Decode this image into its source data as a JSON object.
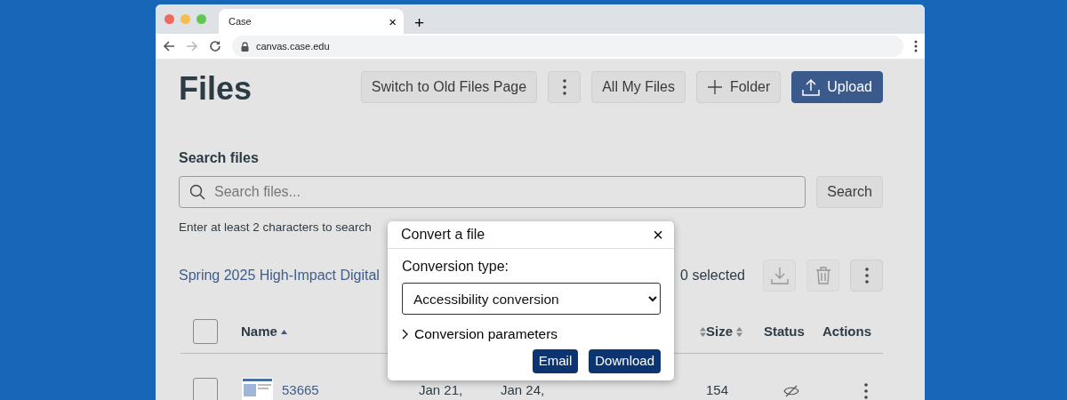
{
  "browser": {
    "tab_title": "Case",
    "tab_close": "×",
    "new_tab": "+",
    "url": "canvas.case.edu",
    "forward_disabled": true
  },
  "page": {
    "title": "Files",
    "toolbar": [
      {
        "kind": "text",
        "label": "Switch to Old Files Page"
      },
      {
        "kind": "more"
      },
      {
        "kind": "text",
        "label": "All My Files"
      },
      {
        "kind": "plus",
        "label": "Folder"
      },
      {
        "kind": "primary",
        "label": "Upload"
      }
    ],
    "search": {
      "label": "Search files",
      "placeholder": "Search files...",
      "button": "Search",
      "hint": "Enter at least 2 characters to search"
    },
    "breadcrumb": "Spring 2025 High-Impact Digital",
    "selected_count": "0 selected",
    "bulk_actions": [
      {
        "kind": "download",
        "disabled": true
      },
      {
        "kind": "trash",
        "disabled": true
      },
      {
        "kind": "more",
        "disabled": false
      }
    ]
  },
  "table": {
    "select_all": {
      "checked": false
    },
    "columns": [
      {
        "label": "Name",
        "sorted": true
      },
      {
        "sorted": false
      },
      {
        "label": "Size",
        "sorted": false
      },
      {
        "label": "Status"
      },
      {
        "label": "Actions"
      }
    ],
    "rows": [
      {
        "checked": false,
        "name": "53665",
        "column_2": "Jan 21,",
        "column_3": "Jan 24,",
        "size": "154"
      }
    ]
  },
  "dialog": {
    "title": "Convert a file",
    "close": "×",
    "field_label": "Conversion type:",
    "value": "Accessibility conversion",
    "section": "Conversion parameters",
    "section_expanded": false,
    "buttons": [
      "Email",
      "Download"
    ]
  }
}
